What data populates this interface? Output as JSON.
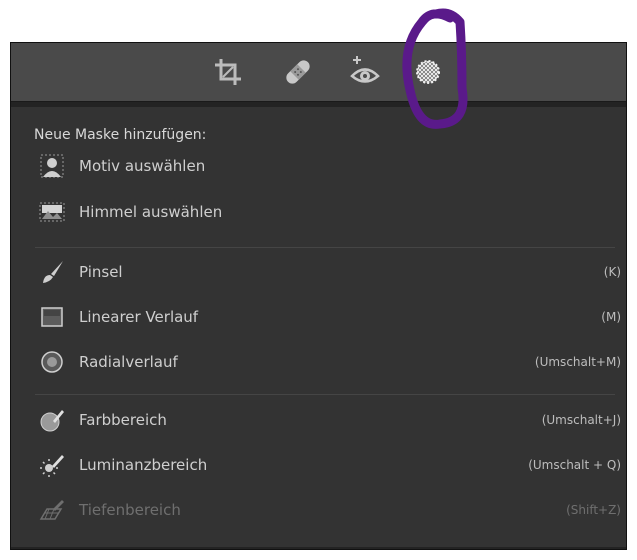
{
  "toolbar": {
    "tools": [
      {
        "icon": "crop-icon"
      },
      {
        "icon": "healing-bandage-icon"
      },
      {
        "icon": "red-eye-icon"
      },
      {
        "icon": "masking-icon"
      }
    ]
  },
  "menu": {
    "heading": "Neue Maske hinzufügen:",
    "items": [
      {
        "label": "Motiv auswählen",
        "shortcut": "",
        "icon": "select-subject-icon"
      },
      {
        "label": "Himmel auswählen",
        "shortcut": "",
        "icon": "select-sky-icon"
      },
      {
        "label": "Pinsel",
        "shortcut": "(K)",
        "icon": "brush-icon"
      },
      {
        "label": "Linearer Verlauf",
        "shortcut": "(M)",
        "icon": "linear-gradient-icon"
      },
      {
        "label": "Radialverlauf",
        "shortcut": "(Umschalt+M)",
        "icon": "radial-gradient-icon"
      },
      {
        "label": "Farbbereich",
        "shortcut": "(Umschalt+J)",
        "icon": "color-range-icon"
      },
      {
        "label": "Luminanzbereich",
        "shortcut": "(Umschalt + Q)",
        "icon": "luminance-range-icon"
      },
      {
        "label": "Tiefenbereich",
        "shortcut": "(Shift+Z)",
        "icon": "depth-range-icon",
        "disabled": true
      }
    ]
  },
  "colors": {
    "panel_bg": "#333333",
    "toolbar_bg": "#4a4a4a",
    "annotation": "#5a1a8a"
  }
}
